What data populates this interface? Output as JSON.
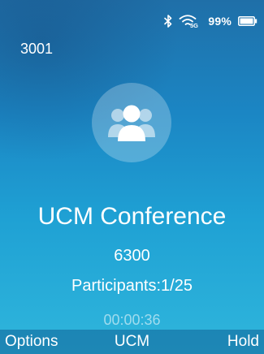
{
  "status_bar": {
    "bluetooth_icon": "bluetooth-icon",
    "wifi_icon": "wifi-5g-icon",
    "wifi_band": "5G",
    "battery_percent": "99%",
    "battery_icon": "battery-icon"
  },
  "extension": "3001",
  "call": {
    "avatar_icon": "group-contacts-icon",
    "title": "UCM Conference",
    "number": "6300",
    "participants": "Participants:1/25",
    "duration": "00:00:36"
  },
  "softkeys": {
    "left": "Options",
    "center": "UCM",
    "right": "Hold"
  },
  "colors": {
    "background_top": "#1f6fa8",
    "background_bottom": "#2fb6dc",
    "text": "#ffffff"
  }
}
